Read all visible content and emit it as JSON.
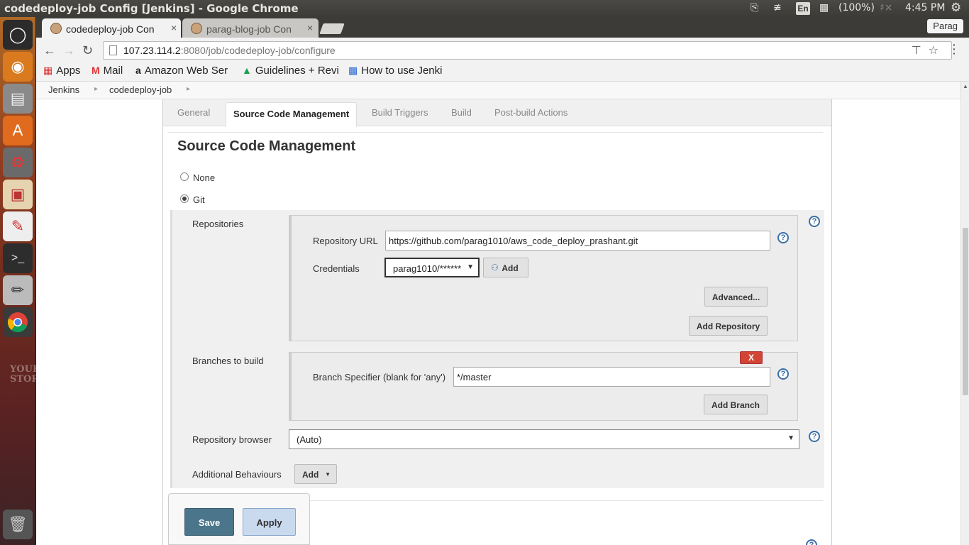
{
  "os": {
    "window_title": "codedeploy-job Config [Jenkins] - Google Chrome",
    "indicators": {
      "battery": "(100%)",
      "keyboard_lang": "En",
      "clock": "4:45 PM"
    },
    "launcher_items": [
      "ubuntu-dash-icon",
      "firefox-icon",
      "files-icon",
      "software-center-icon",
      "system-settings-icon",
      "impress-icon",
      "document-viewer-icon",
      "terminal-icon",
      "text-editor-icon",
      "chrome-icon",
      "trash-icon"
    ],
    "wallpaper_text": "YOUR STORY"
  },
  "browser": {
    "tabs": [
      {
        "label": "codedeploy-job Con",
        "active": true
      },
      {
        "label": "parag-blog-job Con",
        "active": false
      }
    ],
    "profile": "Parag",
    "url_host": "107.23.114.2",
    "url_rest": ":8080/job/codedeploy-job/configure",
    "bookmarks": [
      {
        "icon": "apps-grid-icon",
        "label": "Apps"
      },
      {
        "icon": "gmail-icon",
        "label": "Mail"
      },
      {
        "icon": "amazon-icon",
        "label": "Amazon Web Ser"
      },
      {
        "icon": "google-drive-icon",
        "label": "Guidelines + Revi"
      },
      {
        "icon": "bookmark-icon",
        "label": "How to use Jenki"
      }
    ]
  },
  "jenkins": {
    "breadcrumbs": [
      "Jenkins",
      "codedeploy-job"
    ],
    "config_tabs": [
      "General",
      "Source Code Management",
      "Build Triggers",
      "Build",
      "Post-build Actions"
    ],
    "section_title": "Source Code Management",
    "scm_options": [
      {
        "label": "None",
        "selected": false
      },
      {
        "label": "Git",
        "selected": true
      }
    ],
    "repositories": {
      "label": "Repositories",
      "url_label": "Repository URL",
      "url_value": "https://github.com/parag1010/aws_code_deploy_prashant.git",
      "credentials_label": "Credentials",
      "credentials_value": "parag1010/******",
      "add_label": "Add",
      "advanced_label": "Advanced...",
      "add_repository_label": "Add Repository"
    },
    "branches": {
      "label": "Branches to build",
      "delete_label": "X",
      "specifier_label": "Branch Specifier (blank for 'any')",
      "specifier_value": "*/master",
      "add_branch_label": "Add Branch"
    },
    "repo_browser": {
      "label": "Repository browser",
      "value": "(Auto)"
    },
    "behaviours": {
      "label": "Additional Behaviours",
      "add_label": "Add"
    },
    "help_glyph": "?",
    "actions": {
      "save": "Save",
      "apply": "Apply"
    },
    "colors": {
      "save_bg": "#4b758b",
      "apply_bg": "#c9d9ee",
      "delete_bg": "#d24535"
    }
  }
}
